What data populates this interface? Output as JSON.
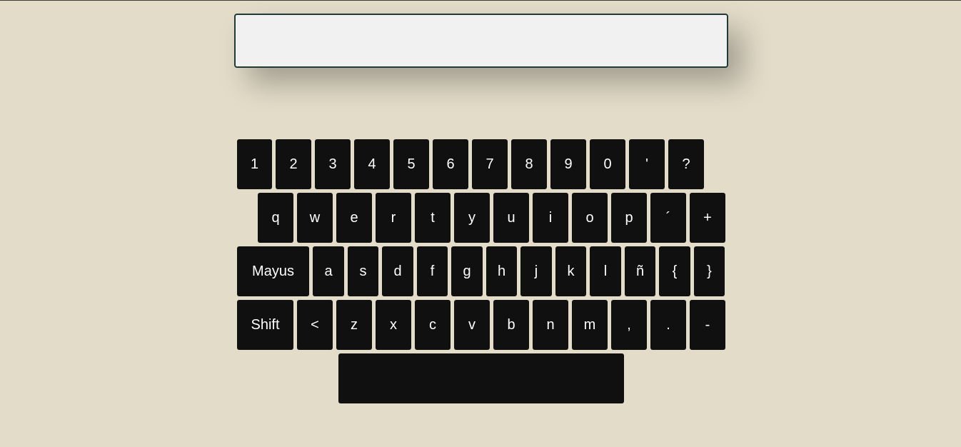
{
  "display": {
    "value": ""
  },
  "keyboard": {
    "rows": [
      [
        "1",
        "2",
        "3",
        "4",
        "5",
        "6",
        "7",
        "8",
        "9",
        "0",
        "'",
        "?"
      ],
      [
        "q",
        "w",
        "e",
        "r",
        "t",
        "y",
        "u",
        "i",
        "o",
        "p",
        "´",
        "+"
      ],
      [
        "Mayus",
        "a",
        "s",
        "d",
        "f",
        "g",
        "h",
        "j",
        "k",
        "l",
        "ñ",
        "{",
        "}"
      ],
      [
        "Shift",
        "<",
        "z",
        "x",
        "c",
        "v",
        "b",
        "n",
        "m",
        ",",
        ".",
        "-"
      ],
      [
        ""
      ]
    ]
  }
}
